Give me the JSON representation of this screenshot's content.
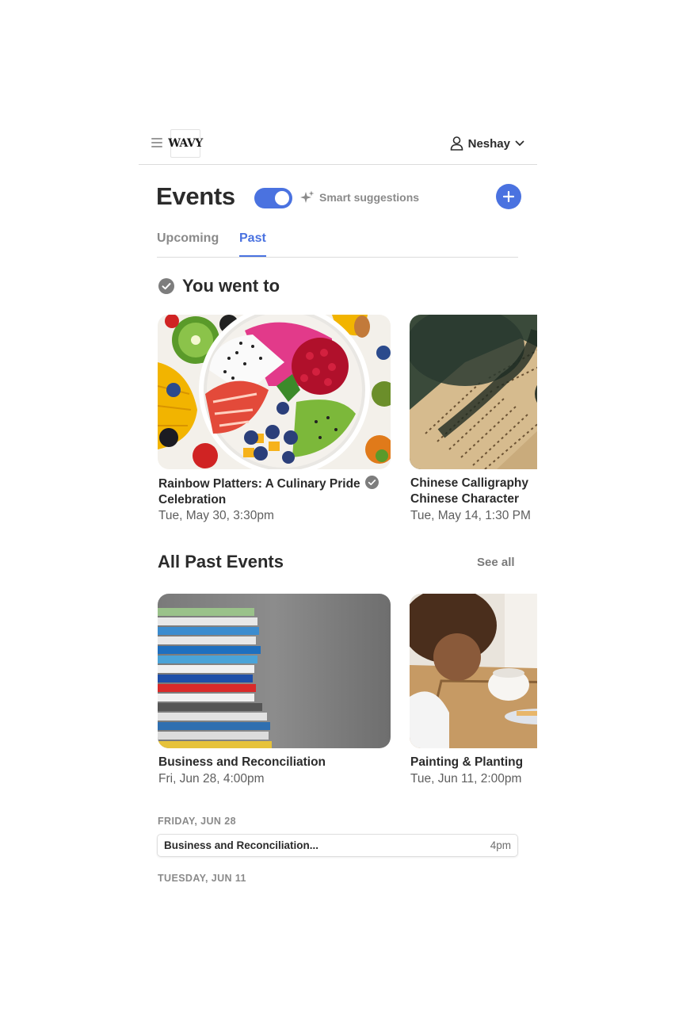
{
  "header": {
    "logo_text": "WAVY",
    "user_name": "Neshay"
  },
  "events": {
    "title": "Events",
    "smart_suggestions_label": "Smart suggestions",
    "smart_suggestions_enabled": true,
    "tabs": [
      {
        "label": "Upcoming",
        "active": false
      },
      {
        "label": "Past",
        "active": true
      }
    ]
  },
  "went_to": {
    "heading": "You went to",
    "cards": [
      {
        "title_line1": "Rainbow Platters: A Culinary Pride",
        "title_line2": "Celebration",
        "date": "Tue, May 30, 3:30pm",
        "attended": true,
        "image": "fruit-bowl"
      },
      {
        "title_line1": "Chinese Calligraphy",
        "title_line2": "Chinese Character",
        "date": "Tue, May 14, 1:30 PM",
        "image": "calligraphy-book"
      }
    ]
  },
  "past_events": {
    "heading": "All Past Events",
    "see_all": "See all",
    "cards": [
      {
        "title": "Business and Reconciliation",
        "date": "Fri, Jun 28, 4:00pm",
        "image": "book-stack"
      },
      {
        "title": "Painting & Planting",
        "date": "Tue, Jun 11, 2:00pm",
        "image": "child-painting"
      }
    ]
  },
  "schedule": {
    "days": [
      {
        "label": "FRIDAY, JUN 28",
        "items": [
          {
            "title": "Business and Reconciliation...",
            "time": "4pm"
          }
        ]
      },
      {
        "label": "TUESDAY, JUN 11",
        "items": []
      }
    ]
  },
  "colors": {
    "accent": "#4a72e0",
    "text": "#2b2b2b",
    "muted": "#8a8a8a"
  }
}
